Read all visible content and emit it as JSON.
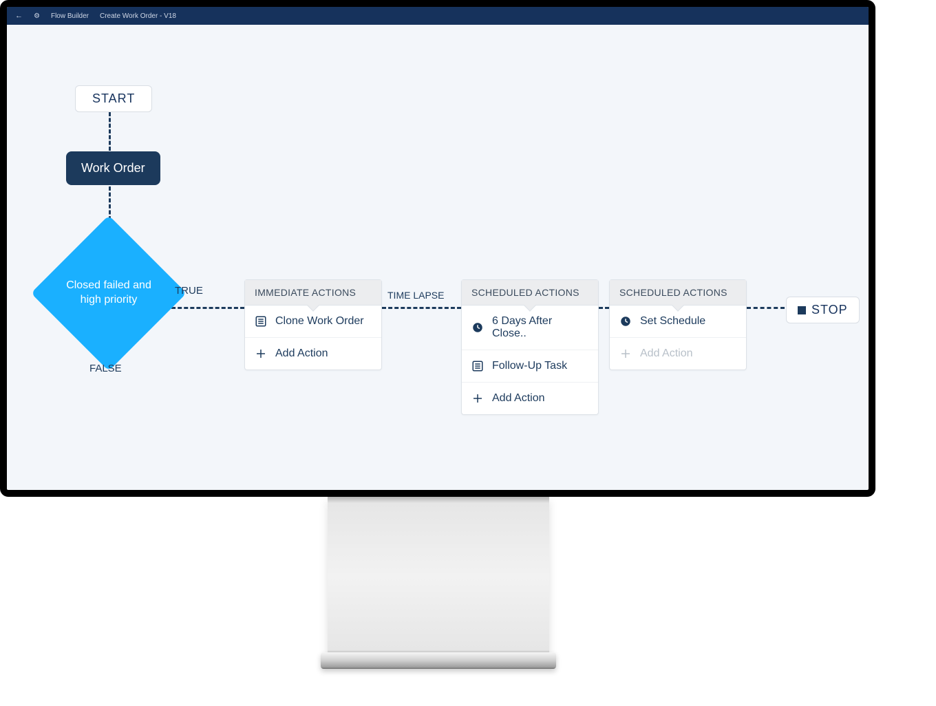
{
  "topbar": {
    "app": "Flow Builder",
    "flow_name": "Create Work Order - V18"
  },
  "nodes": {
    "start": "START",
    "record": "Work Order",
    "decision": "Closed failed and\nhigh priority",
    "stop": "STOP"
  },
  "edges": {
    "true": "TRUE",
    "false": "FALSE",
    "timelapse": "TIME LAPSE"
  },
  "cards": {
    "immediate": {
      "header": "IMMEDIATE ACTIONS",
      "rows": [
        {
          "icon": "list",
          "label": "Clone Work Order"
        },
        {
          "icon": "plus",
          "label": "Add Action"
        }
      ]
    },
    "scheduled1": {
      "header": "SCHEDULED ACTIONS",
      "rows": [
        {
          "icon": "clock",
          "label": "6 Days After Close.."
        },
        {
          "icon": "list",
          "label": "Follow-Up Task"
        },
        {
          "icon": "plus",
          "label": "Add Action"
        }
      ]
    },
    "scheduled2": {
      "header": "SCHEDULED ACTIONS",
      "rows": [
        {
          "icon": "clock",
          "label": "Set Schedule"
        },
        {
          "icon": "plus",
          "label": "Add Action",
          "disabled": true
        }
      ]
    }
  }
}
